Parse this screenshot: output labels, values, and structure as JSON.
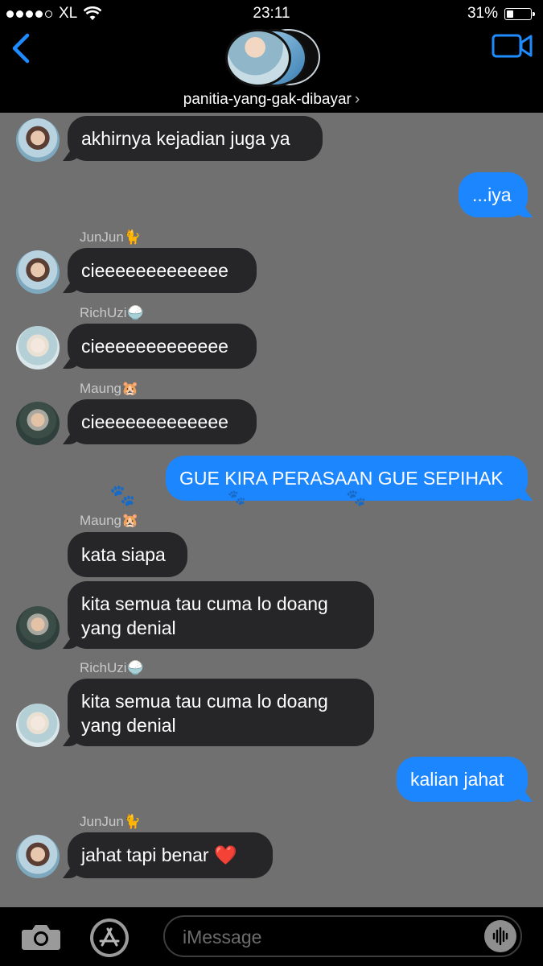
{
  "status_bar": {
    "carrier": "XL",
    "time": "23:11",
    "battery": "31%",
    "battery_level": 0.31
  },
  "header": {
    "group_name": "panitia-yang-gak-dibayar",
    "chevron": "›"
  },
  "messages": [
    {
      "text": "akhirnya kejadian juga ya"
    },
    {
      "text": "...iya"
    },
    {
      "sender": "JunJun🐈",
      "text": "cieeeeeeeeeeeee"
    },
    {
      "sender": "RichUzi🍚",
      "text": "cieeeeeeeeeeeee"
    },
    {
      "sender": "Maung🐹",
      "text": "cieeeeeeeeeeeee"
    },
    {
      "text": "GUE KIRA PERASAAN GUE SEPIHAK"
    },
    {
      "sender": "Maung🐹",
      "text": "kata siapa"
    },
    {
      "text": "kita semua tau cuma lo doang yang denial"
    },
    {
      "sender": "RichUzi🍚",
      "text": "kita semua tau cuma lo doang yang denial"
    },
    {
      "text": "kalian jahat"
    },
    {
      "sender": "JunJun🐈",
      "text": "jahat tapi benar ❤️"
    }
  ],
  "decor": {
    "paw": "🐾"
  },
  "composer": {
    "placeholder": "iMessage"
  }
}
